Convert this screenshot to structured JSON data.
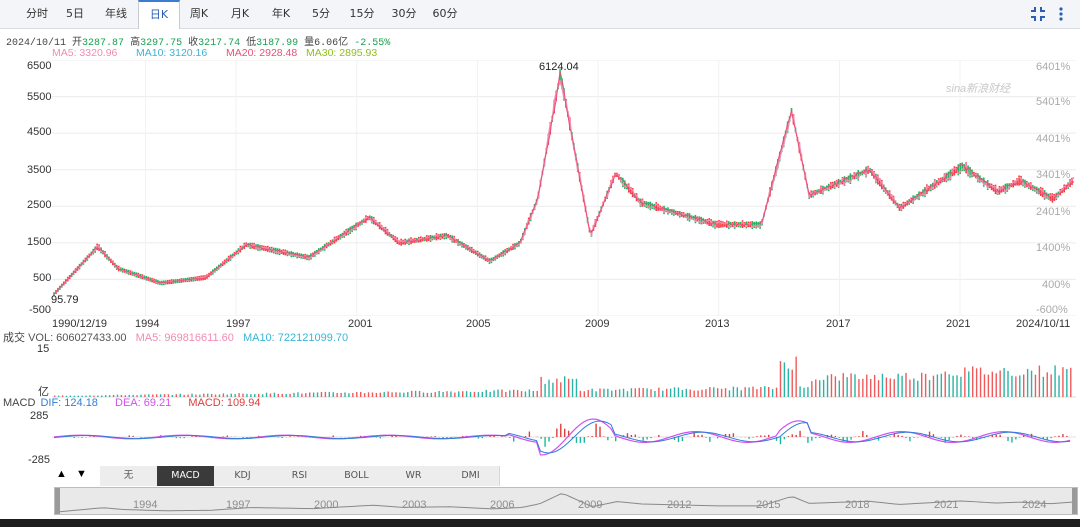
{
  "tabs": [
    "分时",
    "5日",
    "年线",
    "日K",
    "周K",
    "月K",
    "年K",
    "5分",
    "15分",
    "30分",
    "60分"
  ],
  "active_tab": "日K",
  "quote": {
    "date": "2024/10/11",
    "open_label": "开",
    "open": "3287.87",
    "high_label": "高",
    "high": "3297.75",
    "close_label": "收",
    "close": "3217.74",
    "low_label": "低",
    "low": "3187.99",
    "vol_label": "量",
    "vol": "6.06亿",
    "change": "-2.55%"
  },
  "ma": {
    "ma5": "MA5: 3320.96",
    "ma10": "MA10: 3120.16",
    "ma20": "MA20: 2928.48",
    "ma30": "MA30: 2895.93"
  },
  "colors": {
    "up": "#ff3333",
    "down": "#19b85a",
    "ma5": "#f08cb4",
    "ma10": "#3cb4d6",
    "ma20": "#e8507a",
    "ma30": "#8fbf1e",
    "dif": "#2f7ed8",
    "dea": "#d24ff0",
    "macd": "#e03c3c"
  },
  "watermark": "sina新浪财经",
  "volume": {
    "header": "成交",
    "vol": "VOL: 606027433.00",
    "ma5": "MA5: 969816611.60",
    "ma10": "MA10: 722121099.70",
    "top_label": "15",
    "unit_label": "亿"
  },
  "macd": {
    "header": "MACD",
    "dif": "DIF: 124.18",
    "dea": "DEA: 69.21",
    "macd": "MACD: 109.94",
    "top_label": "285",
    "bottom_label": "-285"
  },
  "controls": {
    "up_arrow": "▲",
    "down_arrow": "▼",
    "items": [
      "无",
      "MACD",
      "KDJ",
      "RSI",
      "BOLL",
      "WR",
      "DMI"
    ],
    "active": "MACD"
  },
  "navigator": {
    "years": [
      "1994",
      "1997",
      "2000",
      "2003",
      "2006",
      "2009",
      "2012",
      "2015",
      "2018",
      "2021",
      "2024"
    ]
  },
  "chart_data": {
    "type": "line",
    "title": "",
    "x": [
      "1990/12/19",
      "1992-06",
      "1993-02",
      "1994-07",
      "1996-01",
      "1997-05",
      "1999-06",
      "2001-06",
      "2002-06",
      "2004-01",
      "2005-06",
      "2006-06",
      "2007-01",
      "2007-10",
      "2008-10",
      "2009-08",
      "2010-06",
      "2012-12",
      "2014-06",
      "2015-06",
      "2016-01",
      "2018-01",
      "2019-01",
      "2021-02",
      "2022-04",
      "2023-01",
      "2024-02",
      "2024/10/11"
    ],
    "series": [
      {
        "name": "",
        "values": [
          95.79,
          1400,
          800,
          400,
          550,
          1450,
          1100,
          2200,
          1500,
          1700,
          1000,
          1500,
          2700,
          6124.04,
          1700,
          3400,
          2600,
          2000,
          2000,
          5100,
          2800,
          3500,
          2450,
          3600,
          2900,
          3200,
          2700,
          3217.74
        ]
      }
    ],
    "ylim": [
      -500,
      6500
    ],
    "y_ticks_left": [
      "6500",
      "5500",
      "4500",
      "3500",
      "2500",
      "1500",
      "500",
      "-500"
    ],
    "y_ticks_right": [
      "6401%",
      "5401%",
      "4401%",
      "3401%",
      "2401%",
      "1400%",
      "400%",
      "-600%"
    ],
    "x_tick_labels": [
      "1990/12/19",
      "1994",
      "1997",
      "2001",
      "2005",
      "2009",
      "2013",
      "2017",
      "2021",
      "2024/10/11"
    ],
    "annotations": {
      "max": "6124.04",
      "min": "95.79"
    },
    "grid": true
  }
}
